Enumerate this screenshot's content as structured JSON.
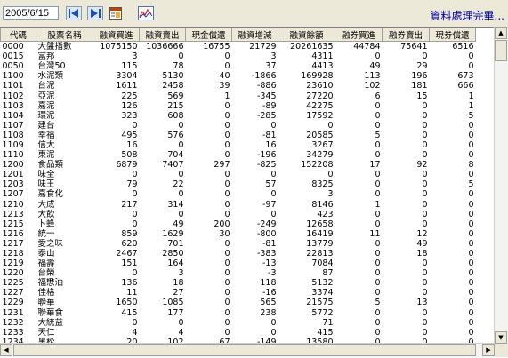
{
  "toolbar": {
    "date_value": "2005/6/15",
    "status_text": "資料處理完畢..."
  },
  "table": {
    "columns": [
      "代碼",
      "股票名稱",
      "融資買進",
      "融資賣出",
      "現金償還",
      "融資增減",
      "融資餘額",
      "融券買進",
      "融券賣出",
      "現券償還"
    ],
    "rows": [
      [
        "0000",
        "大盤指數",
        "1075150",
        "1036666",
        "16755",
        "21729",
        "20261635",
        "44784",
        "75641",
        "6516"
      ],
      [
        "0015",
        "富邦",
        "3",
        "0",
        "0",
        "3",
        "4311",
        "0",
        "0",
        "0"
      ],
      [
        "0050",
        "台灣50",
        "115",
        "78",
        "0",
        "37",
        "4413",
        "49",
        "29",
        "0"
      ],
      [
        "1100",
        "水泥類",
        "3304",
        "5130",
        "40",
        "-1866",
        "169928",
        "113",
        "196",
        "673"
      ],
      [
        "1101",
        "台泥",
        "1611",
        "2458",
        "39",
        "-886",
        "23610",
        "102",
        "181",
        "666"
      ],
      [
        "1102",
        "亞泥",
        "225",
        "569",
        "1",
        "-345",
        "27220",
        "6",
        "15",
        "1"
      ],
      [
        "1103",
        "嘉泥",
        "126",
        "215",
        "0",
        "-89",
        "42275",
        "0",
        "0",
        "1"
      ],
      [
        "1104",
        "環泥",
        "323",
        "608",
        "0",
        "-285",
        "17592",
        "0",
        "0",
        "5"
      ],
      [
        "1107",
        "建台",
        "0",
        "0",
        "0",
        "0",
        "0",
        "0",
        "0",
        "0"
      ],
      [
        "1108",
        "幸福",
        "495",
        "576",
        "0",
        "-81",
        "20585",
        "5",
        "0",
        "0"
      ],
      [
        "1109",
        "信大",
        "16",
        "0",
        "0",
        "16",
        "3267",
        "0",
        "0",
        "0"
      ],
      [
        "1110",
        "東泥",
        "508",
        "704",
        "0",
        "-196",
        "34279",
        "0",
        "0",
        "0"
      ],
      [
        "1200",
        "食品類",
        "6879",
        "7407",
        "297",
        "-825",
        "152208",
        "17",
        "92",
        "8"
      ],
      [
        "1201",
        "味全",
        "0",
        "0",
        "0",
        "0",
        "0",
        "0",
        "0",
        "0"
      ],
      [
        "1203",
        "味王",
        "79",
        "22",
        "0",
        "57",
        "8325",
        "0",
        "0",
        "5"
      ],
      [
        "1207",
        "嘉食化",
        "0",
        "0",
        "0",
        "0",
        "3",
        "0",
        "0",
        "0"
      ],
      [
        "1210",
        "大成",
        "217",
        "314",
        "0",
        "-97",
        "8146",
        "1",
        "0",
        "0"
      ],
      [
        "1213",
        "大飲",
        "0",
        "0",
        "0",
        "0",
        "423",
        "0",
        "0",
        "0"
      ],
      [
        "1215",
        "卜蜂",
        "0",
        "49",
        "200",
        "-249",
        "12658",
        "0",
        "0",
        "0"
      ],
      [
        "1216",
        "統一",
        "859",
        "1629",
        "30",
        "-800",
        "16419",
        "11",
        "12",
        "0"
      ],
      [
        "1217",
        "愛之味",
        "620",
        "701",
        "0",
        "-81",
        "13779",
        "0",
        "49",
        "0"
      ],
      [
        "1218",
        "泰山",
        "2467",
        "2850",
        "0",
        "-383",
        "22813",
        "0",
        "18",
        "0"
      ],
      [
        "1219",
        "福壽",
        "151",
        "164",
        "0",
        "-13",
        "7084",
        "0",
        "0",
        "0"
      ],
      [
        "1220",
        "台榮",
        "0",
        "3",
        "0",
        "-3",
        "87",
        "0",
        "0",
        "0"
      ],
      [
        "1225",
        "福懋油",
        "136",
        "18",
        "0",
        "118",
        "5132",
        "0",
        "0",
        "0"
      ],
      [
        "1227",
        "佳格",
        "11",
        "27",
        "0",
        "-16",
        "3374",
        "0",
        "0",
        "0"
      ],
      [
        "1229",
        "聯華",
        "1650",
        "1085",
        "0",
        "565",
        "21575",
        "5",
        "13",
        "0"
      ],
      [
        "1231",
        "聯華食",
        "415",
        "177",
        "0",
        "238",
        "5772",
        "0",
        "0",
        "0"
      ],
      [
        "1232",
        "大統益",
        "0",
        "0",
        "0",
        "0",
        "71",
        "0",
        "0",
        "0"
      ],
      [
        "1233",
        "天仁",
        "4",
        "4",
        "0",
        "0",
        "415",
        "0",
        "0",
        "0"
      ],
      [
        "1234",
        "黑松",
        "20",
        "102",
        "67",
        "-149",
        "13580",
        "0",
        "0",
        "0"
      ]
    ]
  }
}
